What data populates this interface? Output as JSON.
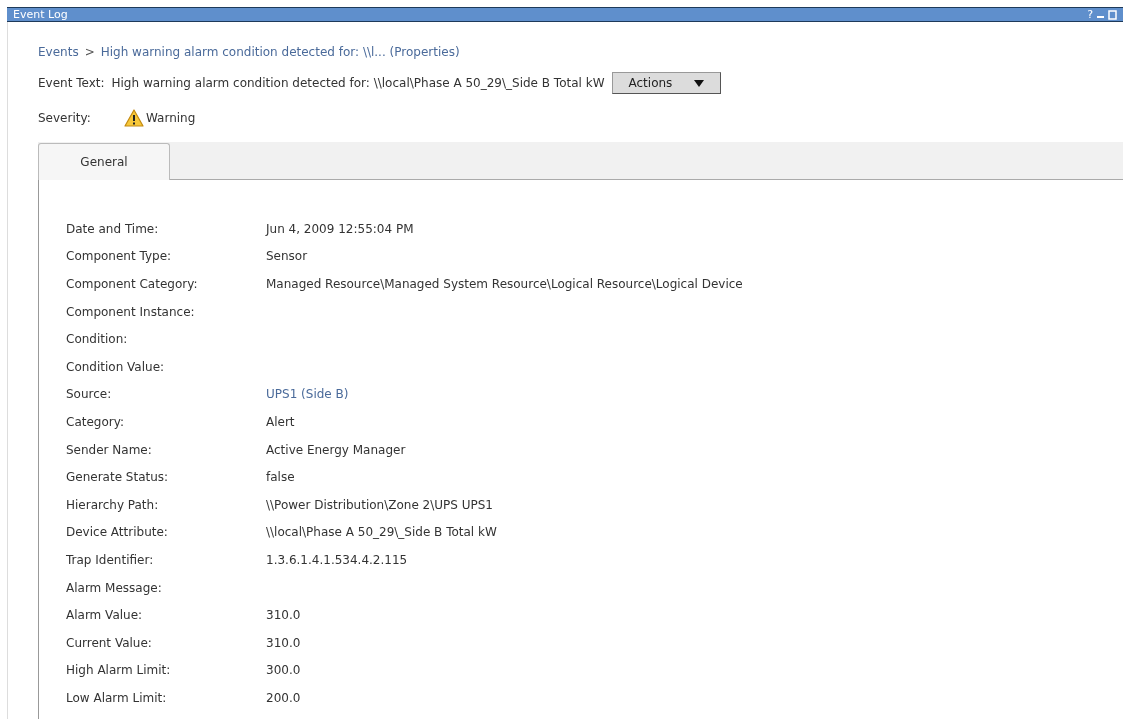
{
  "window": {
    "title": "Event Log",
    "help": "?"
  },
  "breadcrumb": {
    "root": "Events",
    "separator": ">",
    "current": "High warning alarm condition detected for: \\\\l... (Properties)"
  },
  "event_text": {
    "label": "Event Text:",
    "value": "High warning alarm condition detected for: \\\\local\\Phase A 50_29\\_Side B Total kW",
    "actions_button": "Actions"
  },
  "severity": {
    "label": "Severity:",
    "value": "Warning"
  },
  "tabs": [
    {
      "label": "General",
      "selected": true
    }
  ],
  "properties": [
    {
      "label": "Date and Time:",
      "value": "Jun 4, 2009 12:55:04 PM",
      "kind": "text"
    },
    {
      "label": "Component Type:",
      "value": "Sensor",
      "kind": "text"
    },
    {
      "label": "Component Category:",
      "value": "Managed Resource\\Managed System Resource\\Logical Resource\\Logical Device",
      "kind": "text"
    },
    {
      "label": "Component Instance:"
    },
    {
      "label": "Condition:"
    },
    {
      "label": "Condition Value:"
    },
    {
      "label": "Source:",
      "value": "UPS1 (Side B)",
      "kind": "link"
    },
    {
      "label": "Category:",
      "value": "Alert",
      "kind": "text"
    },
    {
      "label": "Sender Name:",
      "value": "Active Energy Manager",
      "kind": "text"
    },
    {
      "label": "Generate Status:",
      "value": "false",
      "kind": "text"
    },
    {
      "label": "Hierarchy Path:",
      "value": "\\\\Power Distribution\\Zone 2\\UPS UPS1",
      "kind": "text"
    },
    {
      "label": "Device Attribute:",
      "value": "\\\\local\\Phase A 50_29\\_Side B Total kW",
      "kind": "text"
    },
    {
      "label": "Trap Identifier:",
      "value": "1.3.6.1.4.1.534.4.2.115",
      "kind": "text"
    },
    {
      "label": "Alarm Message:"
    },
    {
      "label": "Alarm Value:",
      "value": "310.0",
      "kind": "text"
    },
    {
      "label": "Current Value:",
      "value": "310.0",
      "kind": "text"
    },
    {
      "label": "High Alarm Limit:",
      "value": "300.0",
      "kind": "text"
    },
    {
      "label": "Low Alarm Limit:",
      "value": "200.0",
      "kind": "text"
    }
  ]
}
